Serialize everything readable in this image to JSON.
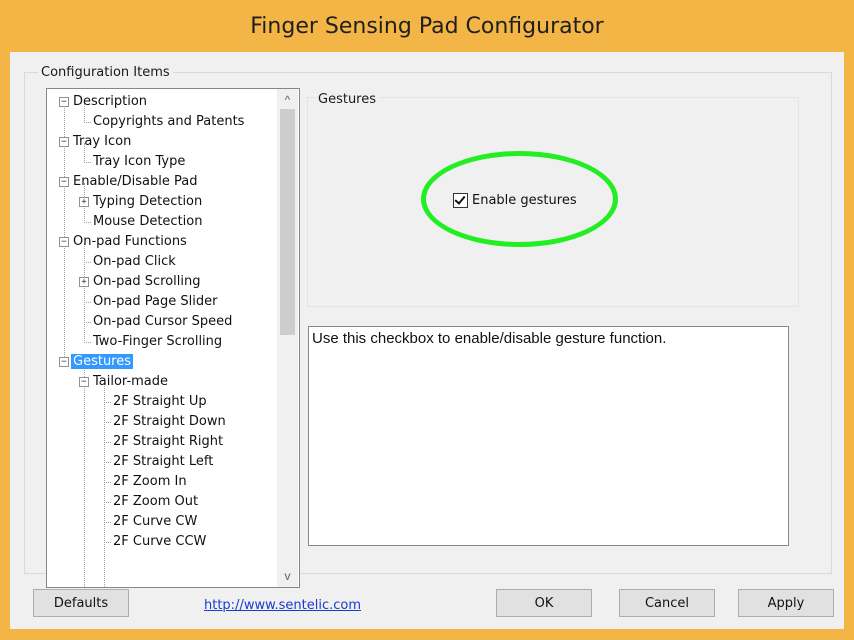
{
  "window": {
    "title": "Finger Sensing Pad Configurator"
  },
  "config_group": {
    "label": "Configuration Items"
  },
  "tree": {
    "items": [
      {
        "label": "Description",
        "expander": "−"
      },
      {
        "label": "Copyrights and Patents"
      },
      {
        "label": "Tray Icon",
        "expander": "−"
      },
      {
        "label": "Tray Icon Type"
      },
      {
        "label": "Enable/Disable Pad",
        "expander": "−"
      },
      {
        "label": "Typing Detection",
        "expander": "+"
      },
      {
        "label": "Mouse Detection"
      },
      {
        "label": "On-pad Functions",
        "expander": "−"
      },
      {
        "label": "On-pad Click"
      },
      {
        "label": "On-pad Scrolling",
        "expander": "+"
      },
      {
        "label": "On-pad Page Slider"
      },
      {
        "label": "On-pad Cursor Speed"
      },
      {
        "label": "Two-Finger Scrolling"
      },
      {
        "label": "Gestures",
        "expander": "−",
        "selected": true
      },
      {
        "label": "Tailor-made",
        "expander": "−"
      },
      {
        "label": "2F Straight Up"
      },
      {
        "label": "2F Straight Down"
      },
      {
        "label": "2F Straight Right"
      },
      {
        "label": "2F Straight Left"
      },
      {
        "label": "2F Zoom In"
      },
      {
        "label": "2F Zoom Out"
      },
      {
        "label": "2F Curve CW"
      },
      {
        "label": "2F Curve CCW"
      }
    ],
    "scroll_up": "^",
    "scroll_down": "v"
  },
  "gestures_panel": {
    "label": "Gestures",
    "checkbox_label": "Enable gestures",
    "checked": true,
    "highlight_color": "#22ee22"
  },
  "description": {
    "text": "Use this checkbox to enable/disable gesture function."
  },
  "footer": {
    "defaults_label": "Defaults",
    "link": "http://www.sentelic.com",
    "ok_label": "OK",
    "cancel_label": "Cancel",
    "apply_label": "Apply"
  }
}
